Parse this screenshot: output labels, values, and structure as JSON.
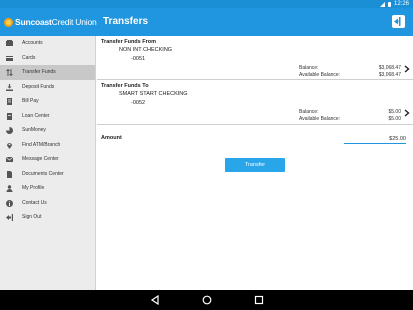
{
  "status_bar": {
    "time": "12:26"
  },
  "app": {
    "logo_bold": "Suncoast",
    "logo_regular": "Credit Union",
    "title": "Transfers"
  },
  "sidebar": {
    "items": [
      {
        "label": "Accounts",
        "icon": "accounts-icon"
      },
      {
        "label": "Cards",
        "icon": "card-icon"
      },
      {
        "label": "Transfer Funds",
        "icon": "transfer-icon",
        "active": true
      },
      {
        "label": "Deposit Funds",
        "icon": "deposit-icon"
      },
      {
        "label": "Bill Pay",
        "icon": "bill-pay-icon"
      },
      {
        "label": "Loan Center",
        "icon": "loan-icon"
      },
      {
        "label": "SunMoney",
        "icon": "chart-icon"
      },
      {
        "label": "Find ATM/Branch",
        "icon": "location-icon"
      },
      {
        "label": "Message Center",
        "icon": "envelope-icon"
      },
      {
        "label": "Documents Center",
        "icon": "document-icon"
      },
      {
        "label": "My Profile",
        "icon": "person-icon"
      },
      {
        "label": "Contact Us",
        "icon": "info-icon"
      },
      {
        "label": "Sign Out",
        "icon": "sign-out-icon"
      }
    ]
  },
  "transfer_from": {
    "heading": "Transfer Funds From",
    "account_name": "NON INT CHECKING",
    "account_number": "-0051",
    "balance_label": "Balance:",
    "balance_value": "$3,068.47",
    "available_label": "Available Balance:",
    "available_value": "$3,068.47"
  },
  "transfer_to": {
    "heading": "Transfer Funds To",
    "account_name": "SMART START CHECKING",
    "account_number": "-0052",
    "balance_label": "Balance:",
    "balance_value": "$5.00",
    "available_label": "Available Balance:",
    "available_value": "$5.00"
  },
  "amount": {
    "label": "Amount",
    "value": "$25.00"
  },
  "transfer_button": {
    "label": "Transfer"
  },
  "colors": {
    "primary": "#2196e0",
    "button": "#29a6ea",
    "logo_orange": "#f7a21b"
  }
}
